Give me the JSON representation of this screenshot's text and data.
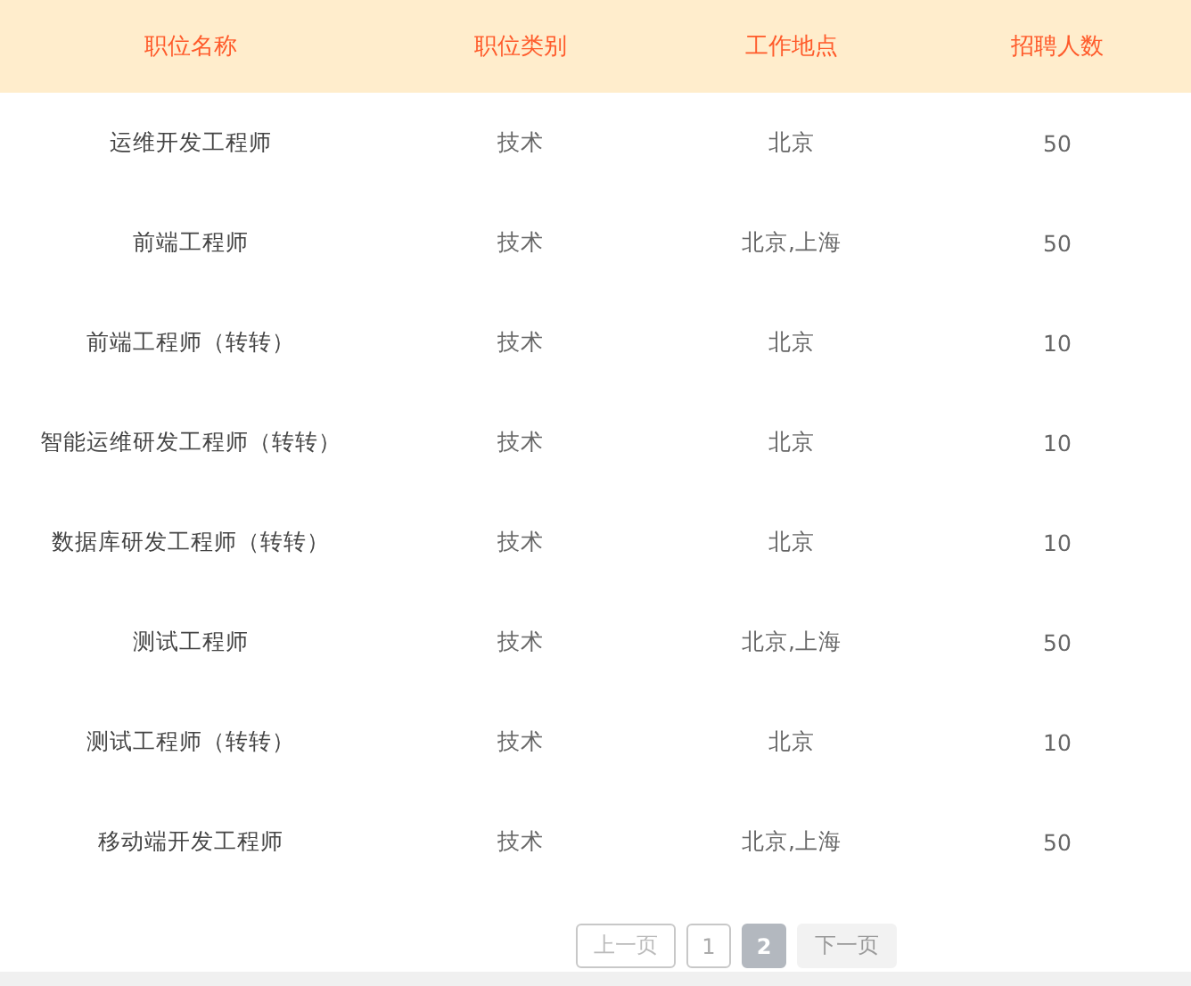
{
  "table": {
    "columns": [
      "职位名称",
      "职位类别",
      "工作地点",
      "招聘人数"
    ],
    "rows": [
      [
        "运维开发工程师",
        "技术",
        "北京",
        "50"
      ],
      [
        "前端工程师",
        "技术",
        "北京,上海",
        "50"
      ],
      [
        "前端工程师（转转）",
        "技术",
        "北京",
        "10"
      ],
      [
        "智能运维研发工程师（转转）",
        "技术",
        "北京",
        "10"
      ],
      [
        "数据库研发工程师（转转）",
        "技术",
        "北京",
        "10"
      ],
      [
        "测试工程师",
        "技术",
        "北京,上海",
        "50"
      ],
      [
        "测试工程师（转转）",
        "技术",
        "北京",
        "10"
      ],
      [
        "移动端开发工程师",
        "技术",
        "北京,上海",
        "50"
      ]
    ]
  },
  "pagination": {
    "prev": {
      "label": "上一页",
      "disabled": false
    },
    "pages": [
      {
        "label": "1",
        "selected": false
      },
      {
        "label": "2",
        "selected": true
      }
    ],
    "next": {
      "label": "下一页",
      "disabled": true
    }
  }
}
